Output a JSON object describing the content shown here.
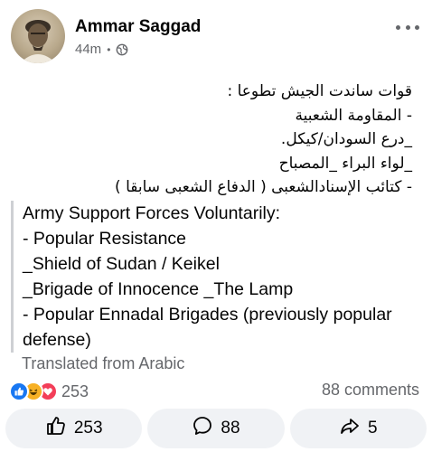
{
  "post": {
    "author": "Ammar Saggad",
    "time": "44m",
    "separator": "•",
    "privacy_icon": "globe-icon",
    "more_icon": "more-options-icon"
  },
  "arabic_lines": [
    "قوات  ساندت الجيش تطوعا :",
    "- المقاومة الشعبية",
    "_درع السودان/كيكل.",
    "_لواء البراء _المصباح",
    "- كتائب الإسنادالشعبى  ( الدفاع الشعبى سابقا )"
  ],
  "translation_lines": [
    "Army Support Forces Voluntarily:",
    "- Popular Resistance",
    "_Shield of Sudan / Keikel",
    "_Brigade of Innocence _The Lamp",
    "- Popular Ennadal Brigades (previously popular",
    "defense)"
  ],
  "translated_from": "Translated from Arabic",
  "reactions": {
    "icons": [
      "like-reaction-icon",
      "haha-reaction-icon",
      "love-reaction-icon"
    ],
    "count": "253"
  },
  "comments_count": "88 comments",
  "actions": {
    "like": "253",
    "comment": "88",
    "share": "5"
  },
  "colors": {
    "secondary_text": "#65676b",
    "action_bg": "#f0f2f5",
    "like_blue": "#1877f2",
    "haha_yellow": "#f7b125",
    "love_red": "#f33e58"
  }
}
